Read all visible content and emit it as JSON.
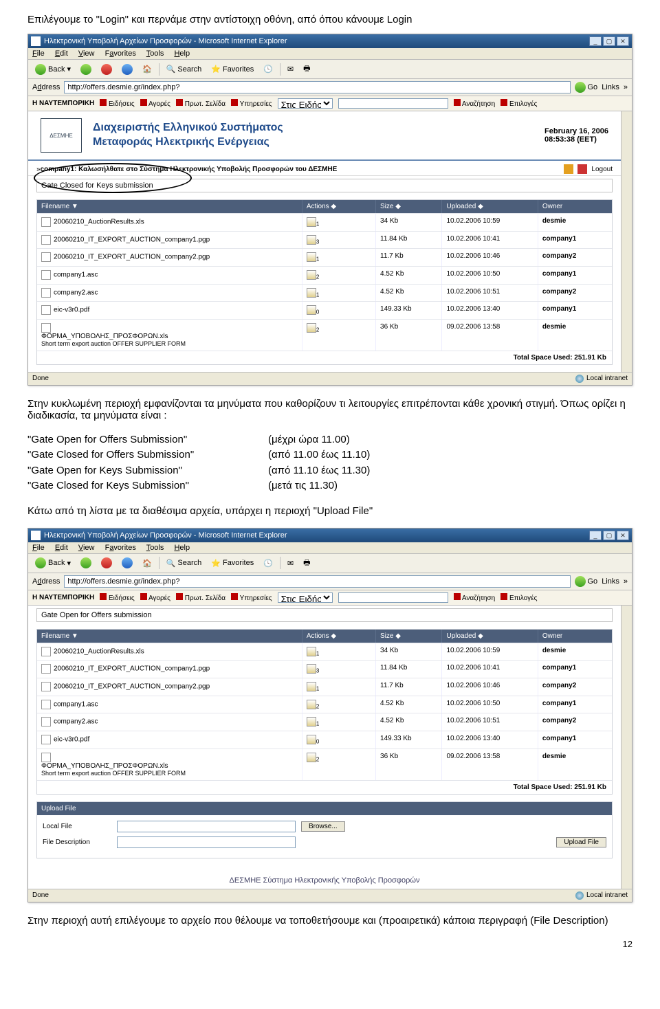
{
  "intro_text": "Επιλέγουμε το \"Login\" και περνάμε στην αντίστοιχη οθόνη, από όπου κάνουμε Login",
  "browser": {
    "title": "Ηλεκτρονική Υποβολή Αρχείων Προσφορών - Microsoft Internet Explorer",
    "menu": {
      "file": "File",
      "edit": "Edit",
      "view": "View",
      "favorites": "Favorites",
      "tools": "Tools",
      "help": "Help"
    },
    "toolbar": {
      "back": "Back",
      "search": "Search",
      "favorites": "Favorites"
    },
    "address_label": "Address",
    "address_url": "http://offers.desmie.gr/index.php?",
    "go": "Go",
    "links": "Links",
    "status_done": "Done",
    "status_right": "Local intranet"
  },
  "navt": {
    "brand": "Η ΝΑΥΤΕΜΠΟΡΙΚΗ",
    "items": [
      "Ειδήσεις",
      "Αγορές",
      "Πρωτ. Σελίδα",
      "Υπηρεσίες"
    ],
    "select": "Στις Ειδήσεις",
    "search": "Αναζήτηση",
    "options": "Επιλογές"
  },
  "app1": {
    "org_title_l1": "Διαχειριστής Ελληνικού Συστήματος",
    "org_title_l2": "Μεταφοράς Ηλεκτρικής Ενέργειας",
    "logo": "ΔΕΣΜΗΕ",
    "date_l1": "February 16, 2006",
    "date_l2": "08:53:38 (EET)",
    "breadcrumb_prefix": " » ",
    "breadcrumb_bold": "company1: Καλωσήλθατε στο Σύστημα Ηλεκτρονικής Υποβολής Προσφορών του ΔΕΣΜΗΕ",
    "logout": "Logout",
    "gate_msg": "Gate Closed for Keys submission",
    "columns": {
      "filename": "Filename ▼",
      "actions": "Actions ◆",
      "size": "Size ◆",
      "uploaded": "Uploaded ◆",
      "owner": "Owner"
    },
    "rows": [
      {
        "name": "20060210_AuctionResults.xls",
        "act": "1",
        "size": "34 Kb",
        "upl": "10.02.2006 10:59",
        "owner": "desmie"
      },
      {
        "name": "20060210_IT_EXPORT_AUCTION_company1.pgp",
        "act": "3",
        "size": "11.84 Kb",
        "upl": "10.02.2006 10:41",
        "owner": "company1"
      },
      {
        "name": "20060210_IT_EXPORT_AUCTION_company2.pgp",
        "act": "1",
        "size": "11.7 Kb",
        "upl": "10.02.2006 10:46",
        "owner": "company2"
      },
      {
        "name": "company1.asc",
        "act": "2",
        "size": "4.52 Kb",
        "upl": "10.02.2006 10:50",
        "owner": "company1"
      },
      {
        "name": "company2.asc",
        "act": "1",
        "size": "4.52 Kb",
        "upl": "10.02.2006 10:51",
        "owner": "company2"
      },
      {
        "name": "eic-v3r0.pdf",
        "act": "0",
        "size": "149.33 Kb",
        "upl": "10.02.2006 13:40",
        "owner": "company1"
      },
      {
        "name_l1": "ΦΟΡΜΑ_ΥΠΟΒΟΛΗΣ_ΠΡΟΣΦΟΡΩΝ.xls",
        "name_l2": "Short term export auction OFFER SUPPLIER FORM",
        "act": "2",
        "size": "36 Kb",
        "upl": "09.02.2006 13:58",
        "owner": "desmie"
      }
    ],
    "total": "Total Space Used: 251.91 Kb"
  },
  "para_after1": "Στην κυκλωμένη περιοχή εμφανίζονται τα μηνύματα που καθορίζουν τι λειτουργίες επιτρέπονται κάθε χρονική στιγμή. Όπως ορίζει η διαδικασία, τα μηνύματα είναι :",
  "messages": [
    {
      "c1": "\"Gate Open for Offers Submission\"",
      "c2": "(μέχρι ώρα 11.00)"
    },
    {
      "c1": "\"Gate Closed for Offers Submission\"",
      "c2": "(από 11.00 έως 11.10)"
    },
    {
      "c1": "\"Gate Open for Keys Submission\"",
      "c2": "(από 11.10 έως 11.30)"
    },
    {
      "c1": "\"Gate Closed for Keys Submission\"",
      "c2": "(μετά τις 11.30)"
    }
  ],
  "para_after_msgs": "Κάτω από τη λίστα με τα διαθέσιμα αρχεία, υπάρχει η περιοχή \"Upload File\"",
  "app2": {
    "gate_msg": "Gate Open for Offers submission",
    "rows": [
      {
        "name": "20060210_AuctionResults.xls",
        "act": "1",
        "size": "34 Kb",
        "upl": "10.02.2006 10:59",
        "owner": "desmie"
      },
      {
        "name": "20060210_IT_EXPORT_AUCTION_company1.pgp",
        "act": "3",
        "size": "11.84 Kb",
        "upl": "10.02.2006 10:41",
        "owner": "company1"
      },
      {
        "name": "20060210_IT_EXPORT_AUCTION_company2.pgp",
        "act": "1",
        "size": "11.7 Kb",
        "upl": "10.02.2006 10:46",
        "owner": "company2"
      },
      {
        "name": "company1.asc",
        "act": "2",
        "size": "4.52 Kb",
        "upl": "10.02.2006 10:50",
        "owner": "company1"
      },
      {
        "name": "company2.asc",
        "act": "1",
        "size": "4.52 Kb",
        "upl": "10.02.2006 10:51",
        "owner": "company2"
      },
      {
        "name": "eic-v3r0.pdf",
        "act": "0",
        "size": "149.33 Kb",
        "upl": "10.02.2006 13:40",
        "owner": "company1"
      },
      {
        "name_l1": "ΦΟΡΜΑ_ΥΠΟΒΟΛΗΣ_ΠΡΟΣΦΟΡΩΝ.xls",
        "name_l2": "Short term export auction OFFER SUPPLIER FORM",
        "act": "2",
        "size": "36 Kb",
        "upl": "09.02.2006 13:58",
        "owner": "desmie"
      }
    ],
    "total": "Total Space Used: 251.91 Kb",
    "upload_head": "Upload File",
    "local_file": "Local File",
    "browse": "Browse...",
    "file_desc": "File Description",
    "upload_btn": "Upload File",
    "footer": "ΔΕΣΜΗΕ Σύστημα Ηλεκτρονικής Υποβολής Προσφορών"
  },
  "para_after2": "Στην περιοχή αυτή επιλέγουμε το αρχείο που θέλουμε να τοποθετήσουμε και (προαιρετικά) κάποια περιγραφή (File Description)",
  "page_num": "12"
}
